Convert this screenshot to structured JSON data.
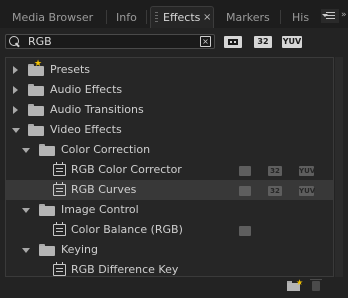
{
  "tabs": {
    "media_browser": "Media Browser",
    "info": "Info",
    "effects": "Effects",
    "effects_close": "×",
    "markers": "Markers",
    "history": "His"
  },
  "search": {
    "value": "RGB",
    "clear": "×"
  },
  "filters": {
    "accelerated": "",
    "bit32": "32",
    "yuv": "YUV"
  },
  "tree": [
    {
      "label": "Presets",
      "expanded": false,
      "type": "preset-folder"
    },
    {
      "label": "Audio Effects",
      "expanded": false,
      "type": "folder"
    },
    {
      "label": "Audio Transitions",
      "expanded": false,
      "type": "folder"
    },
    {
      "label": "Video Effects",
      "expanded": true,
      "type": "folder"
    },
    {
      "label": "Color Correction",
      "expanded": true,
      "type": "folder"
    },
    {
      "label": "RGB Color Corrector",
      "type": "effect",
      "badges": [
        "accelerated",
        "32",
        "YUV"
      ]
    },
    {
      "label": "RGB Curves",
      "type": "effect",
      "selected": true,
      "badges": [
        "accelerated",
        "32",
        "YUV"
      ]
    },
    {
      "label": "Image Control",
      "expanded": true,
      "type": "folder"
    },
    {
      "label": "Color Balance (RGB)",
      "type": "effect",
      "badges": [
        "accelerated"
      ]
    },
    {
      "label": "Keying",
      "expanded": true,
      "type": "folder"
    },
    {
      "label": "RGB Difference Key",
      "type": "effect",
      "badges": []
    }
  ],
  "badge_text": {
    "b32": "32",
    "yuv": "YUV"
  }
}
